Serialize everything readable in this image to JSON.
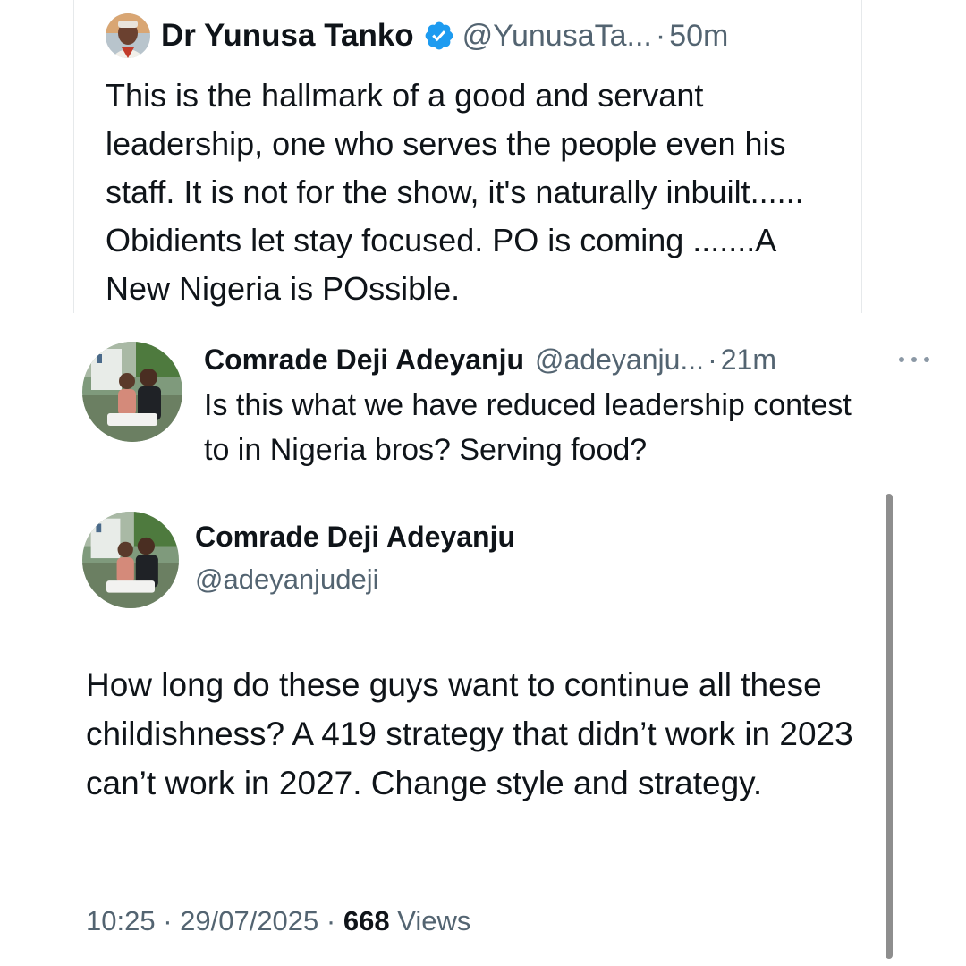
{
  "quoted_tweet": {
    "author_name": "Dr Yunusa Tanko",
    "author_handle": "@YunusaTa...",
    "separator": "·",
    "time": "50m",
    "text": "This is the hallmark of a good and servant leadership, one who serves the people even his staff. It is not for the show, it's naturally inbuilt...... Obidients let stay focused. PO is coming .......A New Nigeria is POssible.",
    "verified_badge_color": "#1d9bf0"
  },
  "reply_tweet": {
    "author_name": "Comrade Deji Adeyanju",
    "author_handle": "@adeyanju...",
    "separator": "·",
    "time": "21m",
    "text": "Is this what we have reduced leadership contest to in Nigeria bros? Serving food?",
    "more_icon": "more-horizontal-icon"
  },
  "main_tweet": {
    "author_name": "Comrade Deji Adeyanju",
    "author_handle": "@adeyanjudeji",
    "text": "How long do these guys want to continue all these childishness? A 419 strategy that didn’t work in 2023 can’t work in 2027. Change style and strategy.",
    "timestamp": "10:25 · 29/07/2025 ·",
    "views_count": "668",
    "views_label": "Views"
  },
  "colors": {
    "text_primary": "#0f1419",
    "text_secondary": "#536471",
    "divider": "#e6e9eb",
    "scrollbar": "#8e8e8e"
  }
}
